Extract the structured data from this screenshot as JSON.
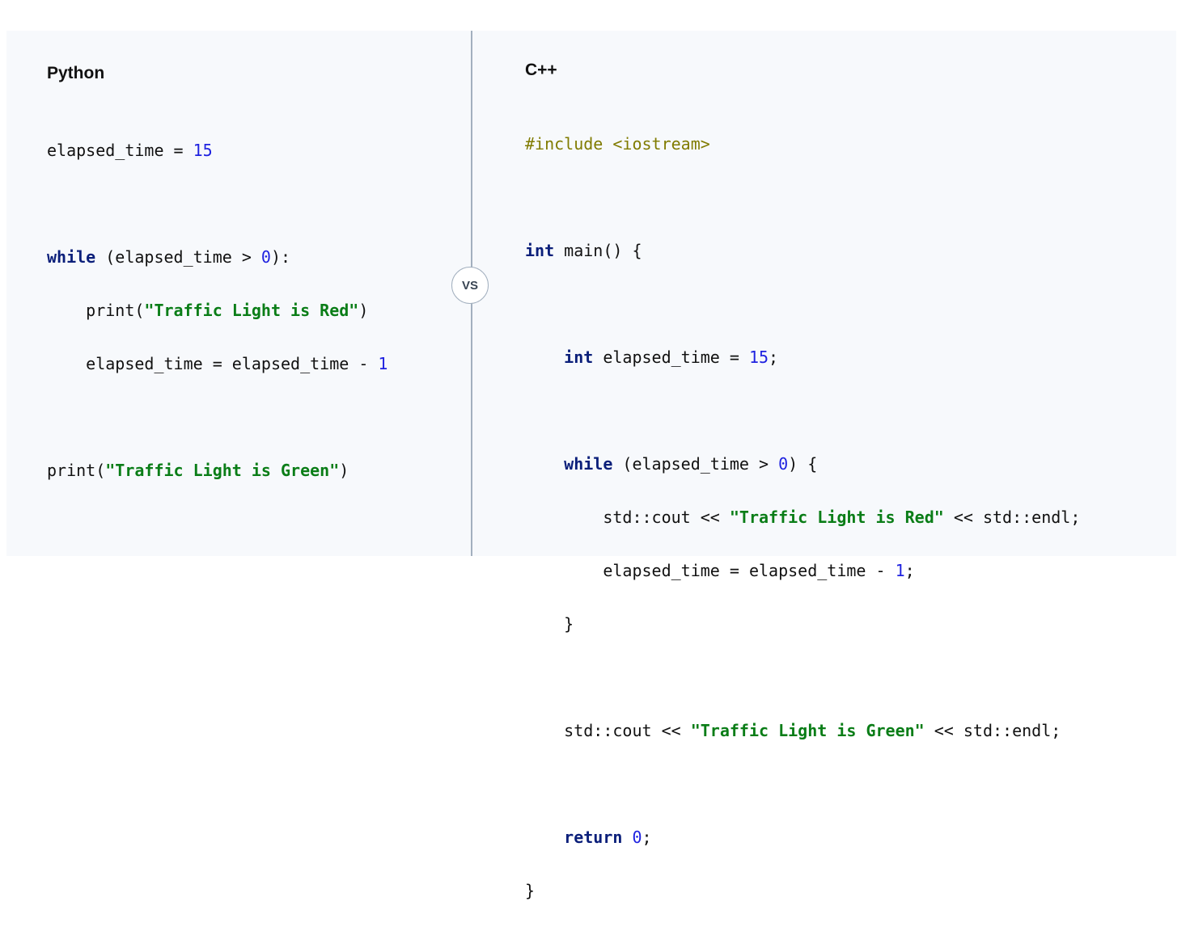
{
  "divider_label": "VS",
  "python": {
    "title": "Python",
    "code": {
      "var": "elapsed_time",
      "init": "15",
      "while_kw": "while",
      "cond_open": " (elapsed_time > ",
      "zero": "0",
      "cond_close": "):",
      "print_fn": "print(",
      "red_msg": "\"Traffic Light is Red\"",
      "close_paren": ")",
      "decrement": "elapsed_time = elapsed_time - ",
      "one": "1",
      "green_msg": "\"Traffic Light is Green\""
    }
  },
  "cpp": {
    "title": "C++",
    "code": {
      "include": "#include <iostream>",
      "int_kw": "int",
      "main_sig": " main() {",
      "var_decl": " elapsed_time = ",
      "init": "15",
      "semicolon": ";",
      "while_kw": "while",
      "cond_open": " (elapsed_time > ",
      "zero": "0",
      "cond_close": ") {",
      "cout": "std::cout << ",
      "red_msg": "\"Traffic Light is Red\"",
      "endl": " << std::endl;",
      "decrement": "elapsed_time = elapsed_time - ",
      "one": "1",
      "close_brace": "}",
      "green_msg": "\"Traffic Light is Green\"",
      "return_kw": "return",
      "return_zero": "0"
    }
  }
}
